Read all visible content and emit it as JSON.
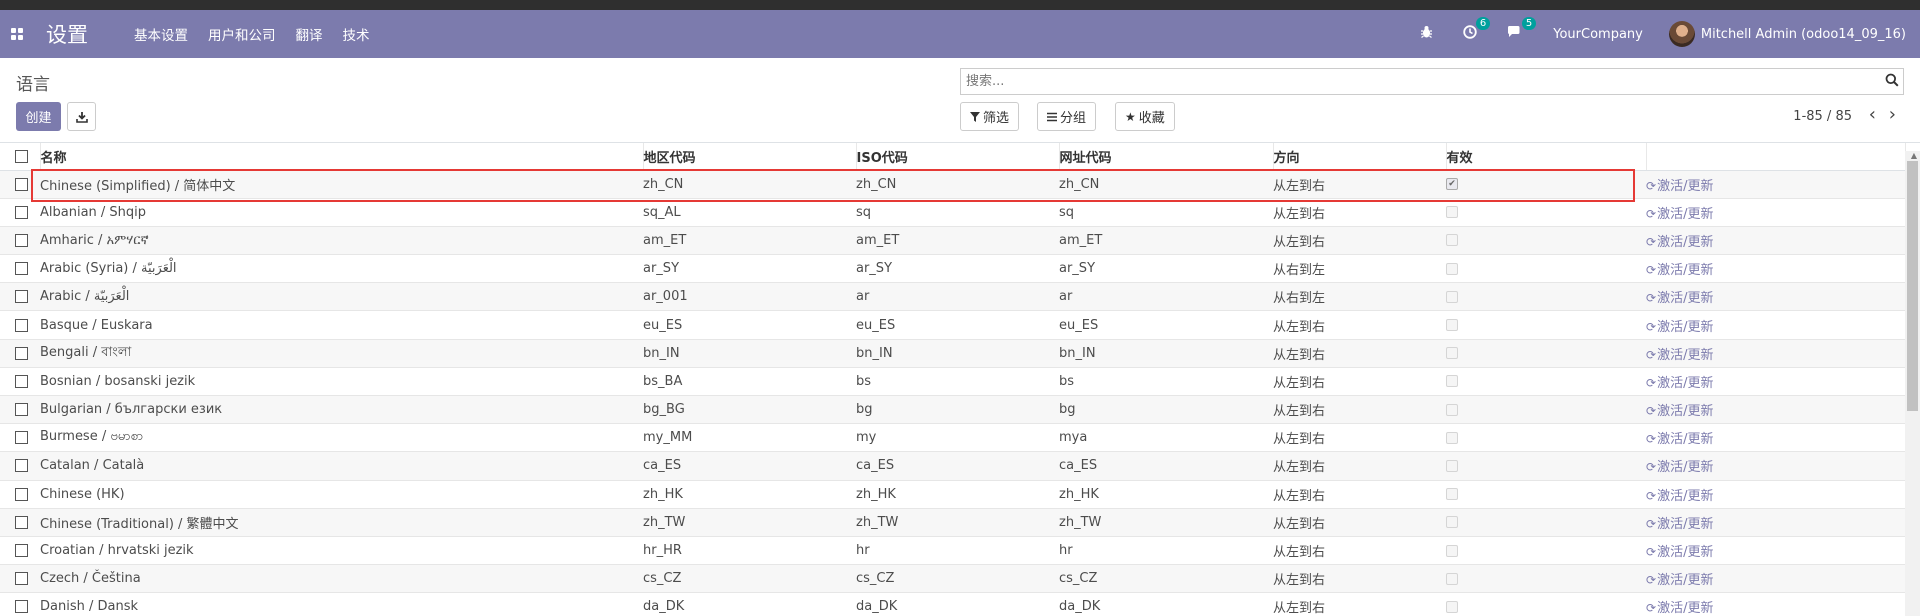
{
  "navbar": {
    "title": "设置",
    "menu": [
      "基本设置",
      "用户和公司",
      "翻译",
      "技术"
    ],
    "activity_count": "6",
    "message_count": "5",
    "company": "YourCompany",
    "user": "Mitchell Admin (odoo14_09_16)"
  },
  "control_panel": {
    "breadcrumb": "语言",
    "create_label": "创建",
    "search_placeholder": "搜索...",
    "filter_label": "筛选",
    "group_label": "分组",
    "favorites_label": "收藏",
    "pager": "1-85 / 85"
  },
  "table": {
    "headers": [
      "名称",
      "地区代码",
      "ISO代码",
      "网址代码",
      "方向",
      "有效"
    ],
    "action_label": "激活/更新",
    "rows": [
      {
        "name": "Chinese (Simplified) / 简体中文",
        "code": "zh_CN",
        "iso": "zh_CN",
        "url": "zh_CN",
        "dir": "从左到右",
        "active": true
      },
      {
        "name": "Albanian / Shqip",
        "code": "sq_AL",
        "iso": "sq",
        "url": "sq",
        "dir": "从左到右",
        "active": false
      },
      {
        "name": "Amharic / አምሃርኛ",
        "code": "am_ET",
        "iso": "am_ET",
        "url": "am_ET",
        "dir": "从左到右",
        "active": false
      },
      {
        "name": "Arabic (Syria) / الْعَرَبيّة",
        "code": "ar_SY",
        "iso": "ar_SY",
        "url": "ar_SY",
        "dir": "从右到左",
        "active": false
      },
      {
        "name": "Arabic / الْعَرَبيّة",
        "code": "ar_001",
        "iso": "ar",
        "url": "ar",
        "dir": "从右到左",
        "active": false
      },
      {
        "name": "Basque / Euskara",
        "code": "eu_ES",
        "iso": "eu_ES",
        "url": "eu_ES",
        "dir": "从左到右",
        "active": false
      },
      {
        "name": "Bengali / বাংলা",
        "code": "bn_IN",
        "iso": "bn_IN",
        "url": "bn_IN",
        "dir": "从左到右",
        "active": false
      },
      {
        "name": "Bosnian / bosanski jezik",
        "code": "bs_BA",
        "iso": "bs",
        "url": "bs",
        "dir": "从左到右",
        "active": false
      },
      {
        "name": "Bulgarian / български език",
        "code": "bg_BG",
        "iso": "bg",
        "url": "bg",
        "dir": "从左到右",
        "active": false
      },
      {
        "name": "Burmese / ဗမာစာ",
        "code": "my_MM",
        "iso": "my",
        "url": "mya",
        "dir": "从左到右",
        "active": false
      },
      {
        "name": "Catalan / Català",
        "code": "ca_ES",
        "iso": "ca_ES",
        "url": "ca_ES",
        "dir": "从左到右",
        "active": false
      },
      {
        "name": "Chinese (HK)",
        "code": "zh_HK",
        "iso": "zh_HK",
        "url": "zh_HK",
        "dir": "从左到右",
        "active": false
      },
      {
        "name": "Chinese (Traditional) / 繁體中文",
        "code": "zh_TW",
        "iso": "zh_TW",
        "url": "zh_TW",
        "dir": "从左到右",
        "active": false
      },
      {
        "name": "Croatian / hrvatski jezik",
        "code": "hr_HR",
        "iso": "hr",
        "url": "hr",
        "dir": "从左到右",
        "active": false
      },
      {
        "name": "Czech / Čeština",
        "code": "cs_CZ",
        "iso": "cs_CZ",
        "url": "cs_CZ",
        "dir": "从左到右",
        "active": false
      },
      {
        "name": "Danish / Dansk",
        "code": "da_DK",
        "iso": "da_DK",
        "url": "da_DK",
        "dir": "从左到右",
        "active": false
      }
    ]
  },
  "colors": {
    "navbar": "#7c7bad",
    "highlight": "#e53935",
    "badge": "#00a09d"
  }
}
